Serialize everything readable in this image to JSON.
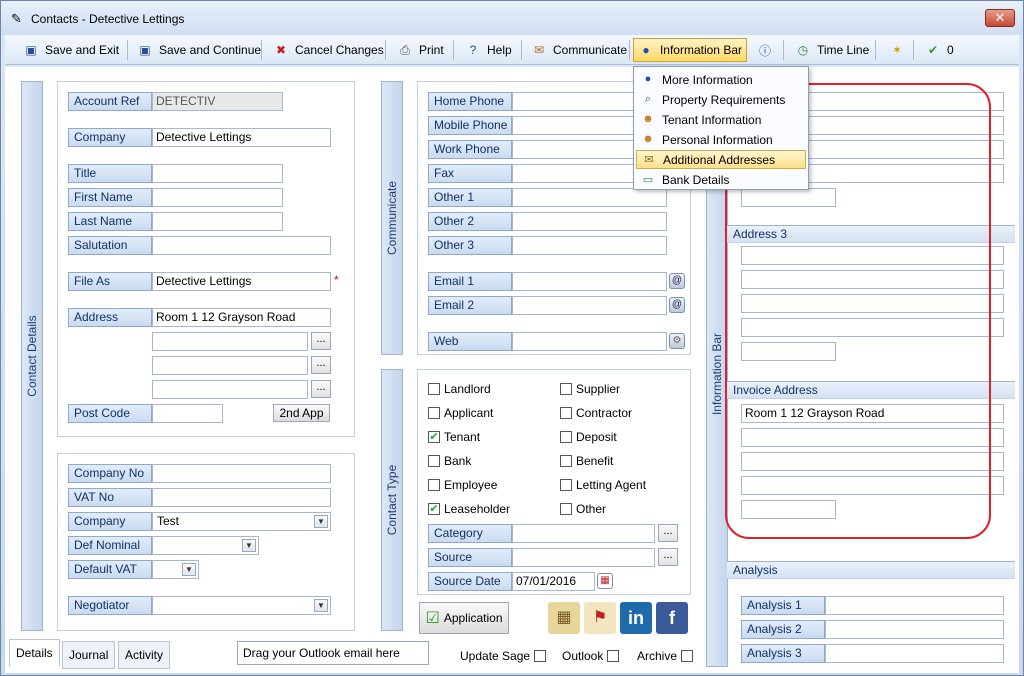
{
  "window": {
    "title": "Contacts  - Detective Lettings"
  },
  "toolbar": {
    "save_exit": "Save and Exit",
    "save_continue": "Save and Continue",
    "cancel_changes": "Cancel Changes",
    "print": "Print",
    "help": "Help",
    "communicate": "Communicate",
    "information_bar": "Information Bar",
    "time_line": "Time Line",
    "check_count": "0"
  },
  "info_menu": {
    "items": [
      "More Information",
      "Property Requirements",
      "Tenant Information",
      "Personal Information",
      "Additional Addresses",
      "Bank Details"
    ]
  },
  "side_tabs": {
    "contact_details": "Contact Details",
    "communicate": "Communicate",
    "contact_type": "Contact Type",
    "information_bar": "Information Bar"
  },
  "contact": {
    "account_ref_label": "Account Ref",
    "account_ref": "DETECTIV",
    "company_label": "Company",
    "company": "Detective Lettings",
    "title_label": "Title",
    "first_name_label": "First Name",
    "last_name_label": "Last Name",
    "salutation_label": "Salutation",
    "file_as_label": "File As",
    "file_as": "Detective Lettings",
    "required_mark": "*",
    "address_label": "Address",
    "address1": "Room 1 12 Grayson Road",
    "post_code_label": "Post Code",
    "second_app": "2nd App"
  },
  "finance": {
    "company_no_label": "Company No",
    "vat_no_label": "VAT No",
    "company_label": "Company",
    "company": "Test",
    "def_nominal_label": "Def Nominal",
    "default_vat_label": "Default VAT",
    "negotiator_label": "Negotiator"
  },
  "communicate": {
    "home_phone": "Home Phone",
    "mobile_phone": "Mobile Phone",
    "work_phone": "Work Phone",
    "fax": "Fax",
    "other1": "Other 1",
    "other2": "Other 2",
    "other3": "Other 3",
    "email1": "Email 1",
    "email2": "Email 2",
    "web": "Web"
  },
  "contact_type": {
    "landlord": "Landlord",
    "supplier": "Supplier",
    "applicant": "Applicant",
    "contractor": "Contractor",
    "tenant": "Tenant",
    "deposit": "Deposit",
    "bank": "Bank",
    "benefit": "Benefit",
    "employee": "Employee",
    "letting_agent": "Letting Agent",
    "leaseholder": "Leaseholder",
    "other": "Other",
    "category_label": "Category",
    "source_label": "Source",
    "source_date_label": "Source Date",
    "source_date": "07/01/2016"
  },
  "application_button": "Application",
  "social": {
    "linkedin": "in",
    "facebook": "f"
  },
  "info_bar": {
    "address3": "Address 3",
    "invoice_address": "Invoice Address",
    "invoice_line1": "Room 1 12 Grayson Road",
    "analysis": "Analysis",
    "analysis1": "Analysis 1",
    "analysis2": "Analysis 2",
    "analysis3": "Analysis 3"
  },
  "bottom_tabs": [
    "Details",
    "Journal",
    "Activity"
  ],
  "footer": {
    "drag_text": "Drag your Outlook email here",
    "update_sage": "Update Sage",
    "outlook": "Outlook",
    "archive": "Archive"
  },
  "icons": {
    "check": "✔",
    "dots": "..."
  }
}
